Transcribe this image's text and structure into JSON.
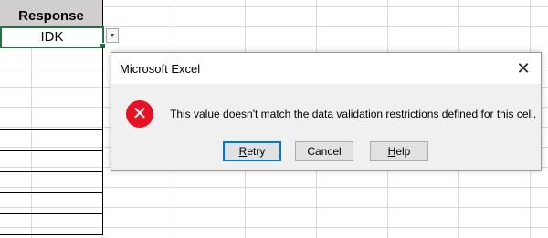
{
  "sheet": {
    "column_header": "Response",
    "active_cell_value": "IDK"
  },
  "dialog": {
    "title": "Microsoft Excel",
    "icon": "error-icon",
    "message": "This value doesn't match the data validation restrictions defined for this cell.",
    "buttons": {
      "retry_first": "R",
      "retry_rest": "etry",
      "cancel": "Cancel",
      "help_first": "H",
      "help_rest": "elp"
    }
  },
  "colors": {
    "selection": "#217346",
    "error": "#e81123",
    "default_button_border": "#0078d7",
    "header_fill": "#d0cece"
  }
}
